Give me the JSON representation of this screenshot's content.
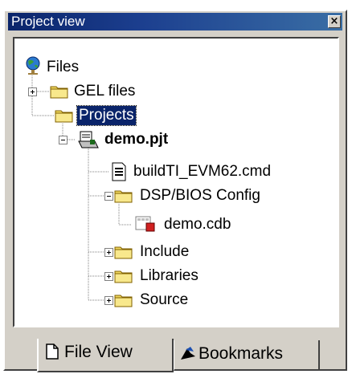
{
  "panel": {
    "title": "Project view",
    "close_glyph": "×"
  },
  "tree": {
    "root": {
      "label": "Files",
      "icon": "globe-icon"
    },
    "gel": {
      "label": "GEL files",
      "icon": "folder-icon",
      "expander": "plus"
    },
    "projects": {
      "label": "Projects",
      "icon": "folder-icon",
      "selected": true
    },
    "project": {
      "label": "demo.pjt",
      "icon": "project-icon",
      "expander": "minus"
    },
    "cmd": {
      "label": "buildTI_EVM62.cmd",
      "icon": "document-icon"
    },
    "dspbios": {
      "label": "DSP/BIOS Config",
      "icon": "folder-icon",
      "expander": "minus"
    },
    "cdb": {
      "label": "demo.cdb",
      "icon": "config-file-icon"
    },
    "include": {
      "label": "Include",
      "icon": "folder-icon",
      "expander": "plus"
    },
    "libraries": {
      "label": "Libraries",
      "icon": "folder-icon",
      "expander": "plus"
    },
    "source": {
      "label": "Source",
      "icon": "folder-icon",
      "expander": "plus"
    }
  },
  "tabs": {
    "file_view": {
      "label": "File View",
      "icon": "page-icon",
      "active": true
    },
    "bookmarks": {
      "label": "Bookmarks",
      "icon": "bookmark-icon",
      "active": false
    }
  },
  "colors": {
    "title_bar": "#0a246a",
    "selection": "#0a246a",
    "folder": "#f0d860",
    "panel": "#d4d0c8"
  }
}
